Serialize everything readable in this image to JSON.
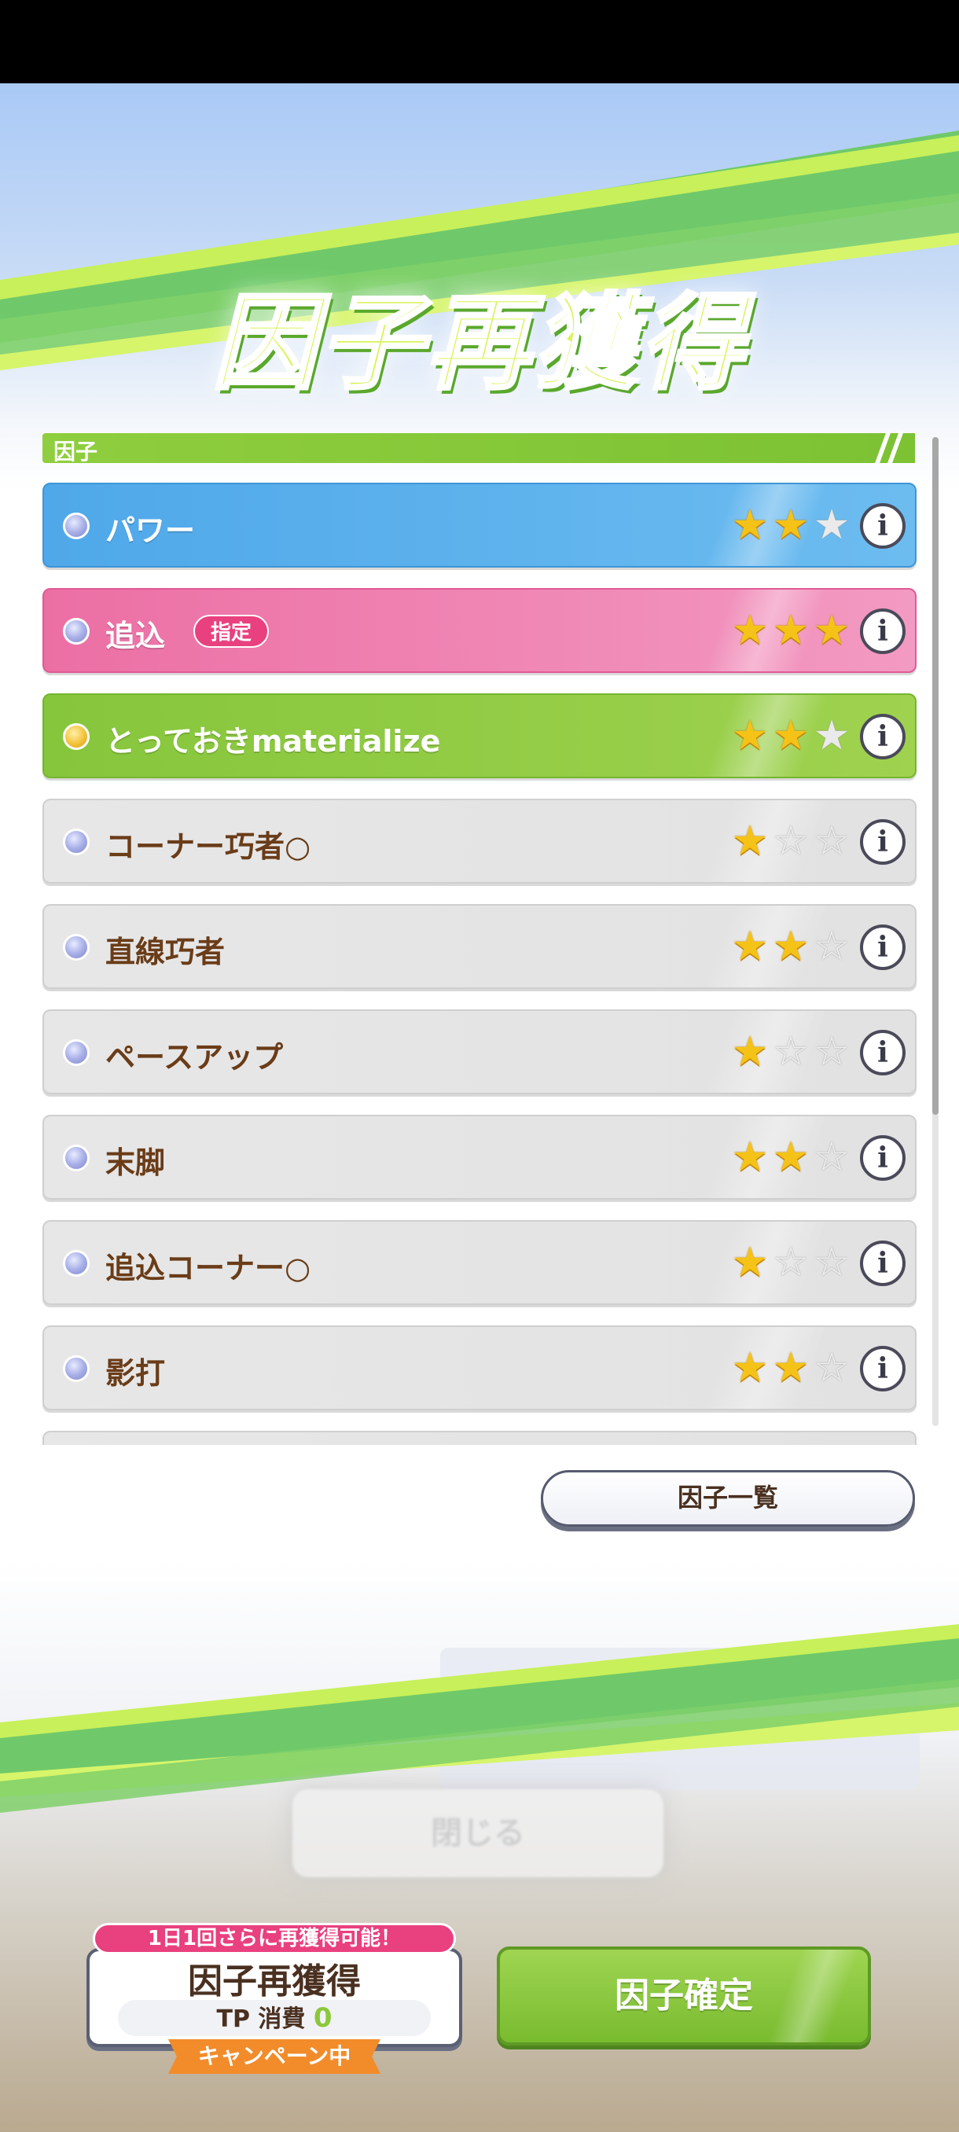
{
  "dialog": {
    "title": "因子再獲得",
    "section_label": "因子",
    "factors": [
      {
        "label": "パワー",
        "color": "blue",
        "stars": 2,
        "badge": null,
        "bullet": "silver"
      },
      {
        "label": "追込",
        "color": "pink",
        "stars": 3,
        "badge": "指定",
        "bullet": "silver"
      },
      {
        "label": "とっておきmaterialize",
        "color": "green",
        "stars": 2,
        "badge": null,
        "bullet": "gold"
      },
      {
        "label": "コーナー巧者○",
        "color": "gray",
        "stars": 1,
        "badge": null,
        "bullet": "silver"
      },
      {
        "label": "直線巧者",
        "color": "gray",
        "stars": 2,
        "badge": null,
        "bullet": "silver"
      },
      {
        "label": "ペースアップ",
        "color": "gray",
        "stars": 1,
        "badge": null,
        "bullet": "silver"
      },
      {
        "label": "末脚",
        "color": "gray",
        "stars": 2,
        "badge": null,
        "bullet": "silver"
      },
      {
        "label": "追込コーナー○",
        "color": "gray",
        "stars": 1,
        "badge": null,
        "bullet": "silver"
      },
      {
        "label": "影打",
        "color": "gray",
        "stars": 2,
        "badge": null,
        "bullet": "silver"
      }
    ],
    "list_button": "因子一覧",
    "close_button": "閉じる"
  },
  "footer": {
    "reget_banner": "1日1回さらに再獲得可能！",
    "reget_title": "因子再獲得",
    "tp_label": "TP 消費",
    "tp_value": "0",
    "campaign": "キャンペーン中",
    "confirm_button": "因子確定"
  },
  "colors": {
    "blue": "#4fa8e9",
    "pink": "#ec6fa4",
    "green": "#86c63c",
    "gray": "#e4e4e4",
    "star": "#f5c318",
    "badge": "#e9407f"
  },
  "icons": [
    "info-icon",
    "star-icon",
    "bullet-icon"
  ]
}
